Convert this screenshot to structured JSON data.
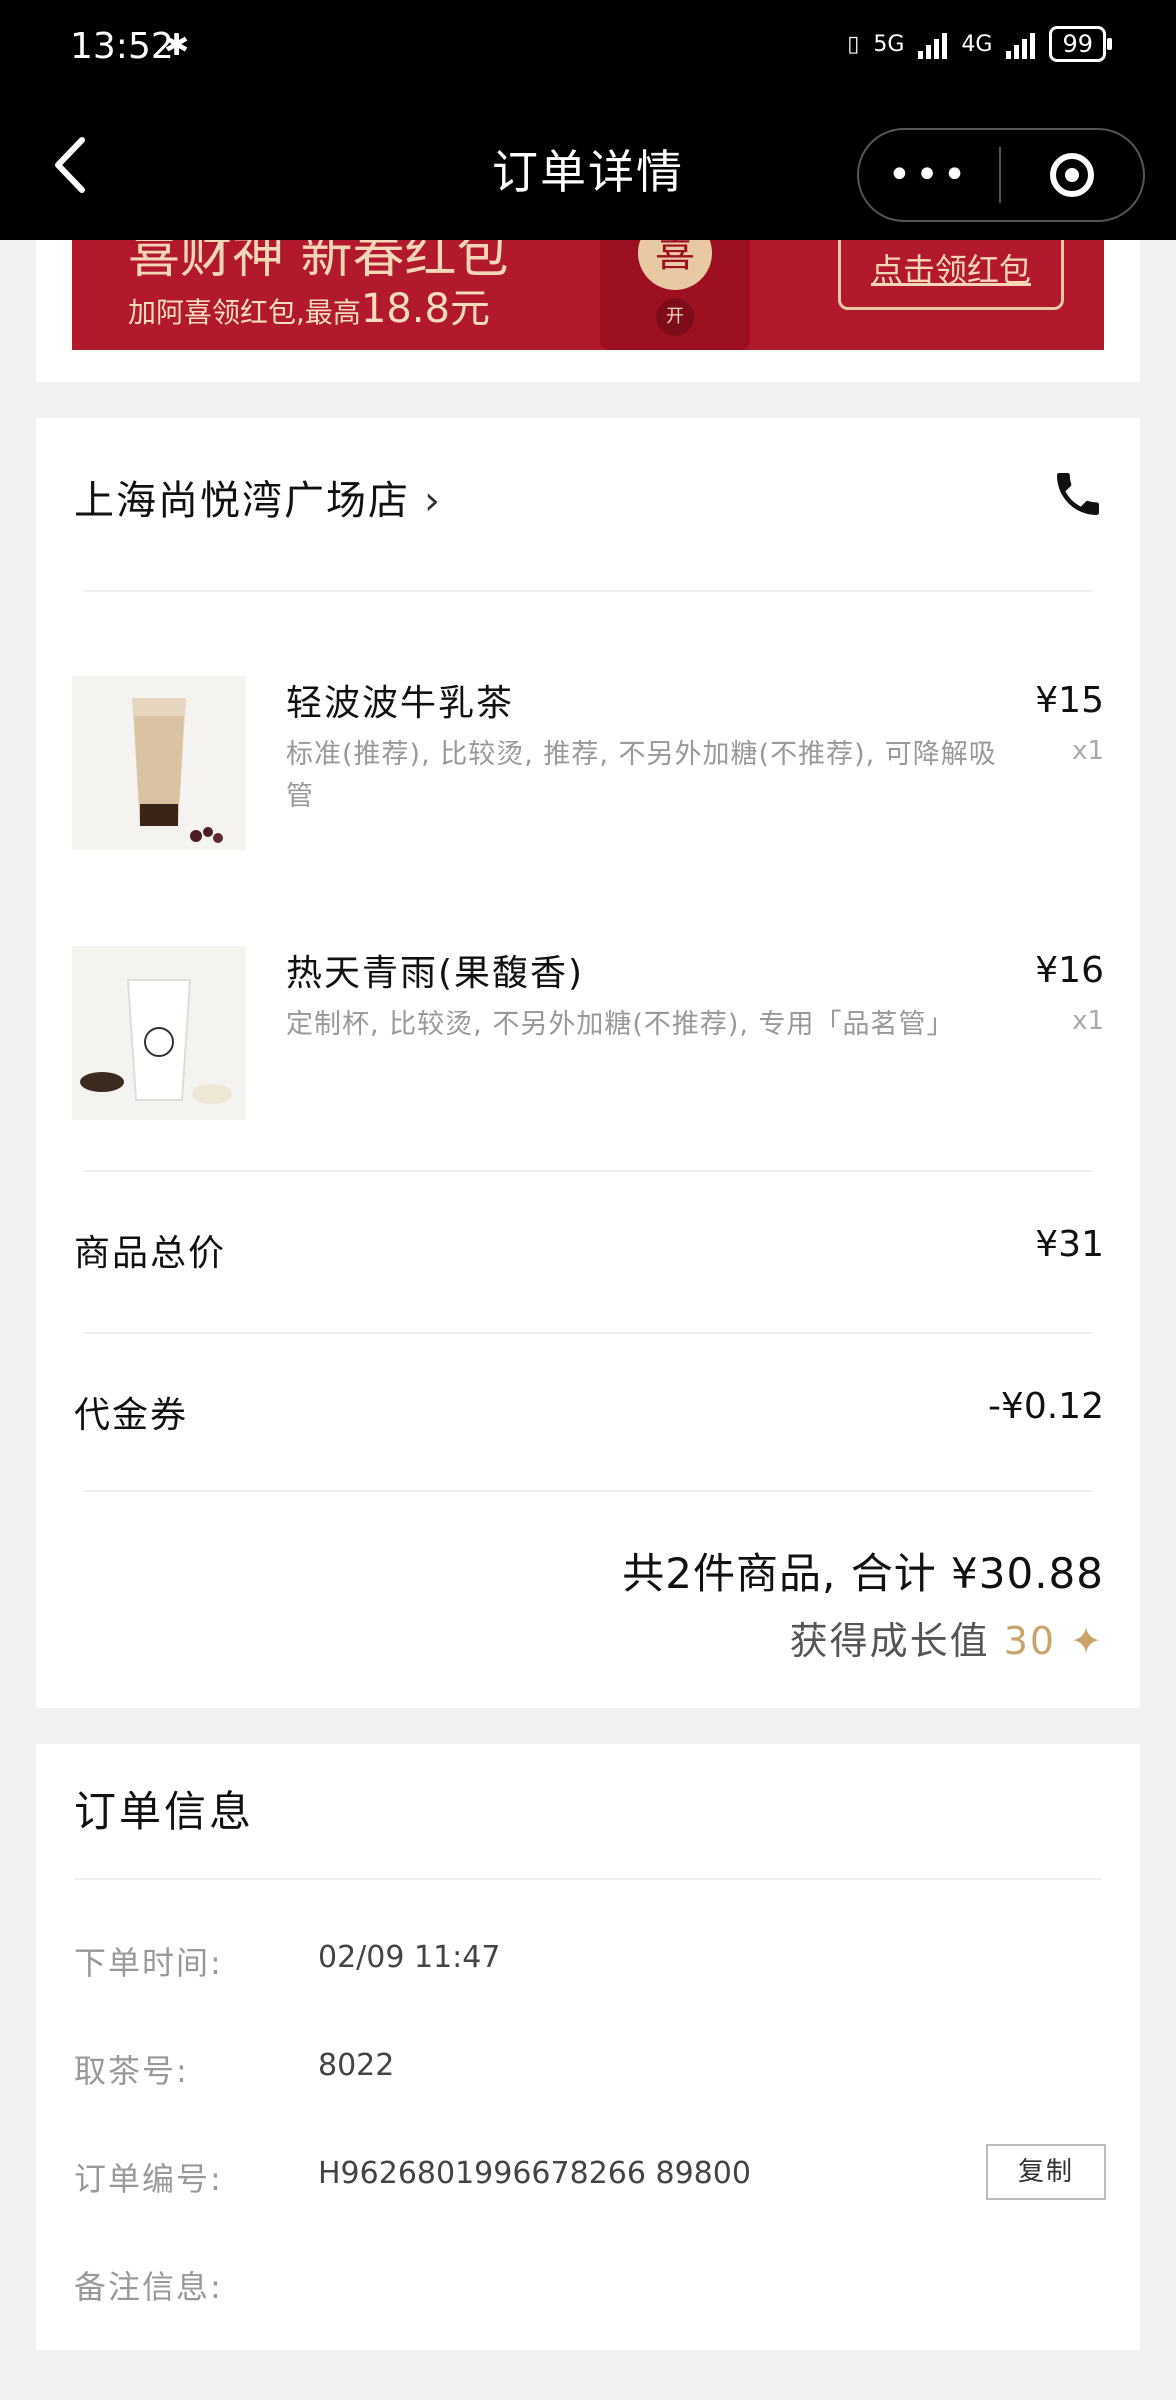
{
  "status_bar": {
    "time": "13:52",
    "network_5g": "5G",
    "network_4g": "4G",
    "battery": "99"
  },
  "nav": {
    "title": "订单详情",
    "more_glyph": "•••"
  },
  "banner": {
    "title": "喜财神 新春红包",
    "subtitle": "加阿喜领红包,最高",
    "amount": "18.8元",
    "envelope_char": "喜",
    "open_label": "开",
    "cta": "点击领红包"
  },
  "store": {
    "name": "上海尚悦湾广场店",
    "chevron": "›"
  },
  "products": [
    {
      "name": "轻波波牛乳茶",
      "spec": "标准(推荐), 比较烫, 推荐, 不另外加糖(不推荐), 可降解吸管",
      "price": "¥15",
      "qty": "x1"
    },
    {
      "name": "热天青雨(果馥香)",
      "spec": "定制杯, 比较烫, 不另外加糖(不推荐), 专用「品茗管」",
      "price": "¥16",
      "qty": "x1"
    }
  ],
  "summary": {
    "subtotal_label": "商品总价",
    "subtotal_value": "¥31",
    "voucher_label": "代金券",
    "voucher_value": "-¥0.12",
    "total_text": "共2件商品, 合计 ¥30.88",
    "growth_label": "获得成长值",
    "growth_value": "30"
  },
  "order_info": {
    "title": "订单信息",
    "time_label": "下单时间:",
    "time_value": "02/09 11:47",
    "pickup_label": "取茶号:",
    "pickup_value": "8022",
    "order_no_label": "订单编号:",
    "order_no_value": "H9626801996678266 89800",
    "copy_label": "复制",
    "note_label": "备注信息:"
  },
  "colors": {
    "brand_red": "#b2192d",
    "gold": "#c9a46a",
    "header_bg": "#000000"
  }
}
